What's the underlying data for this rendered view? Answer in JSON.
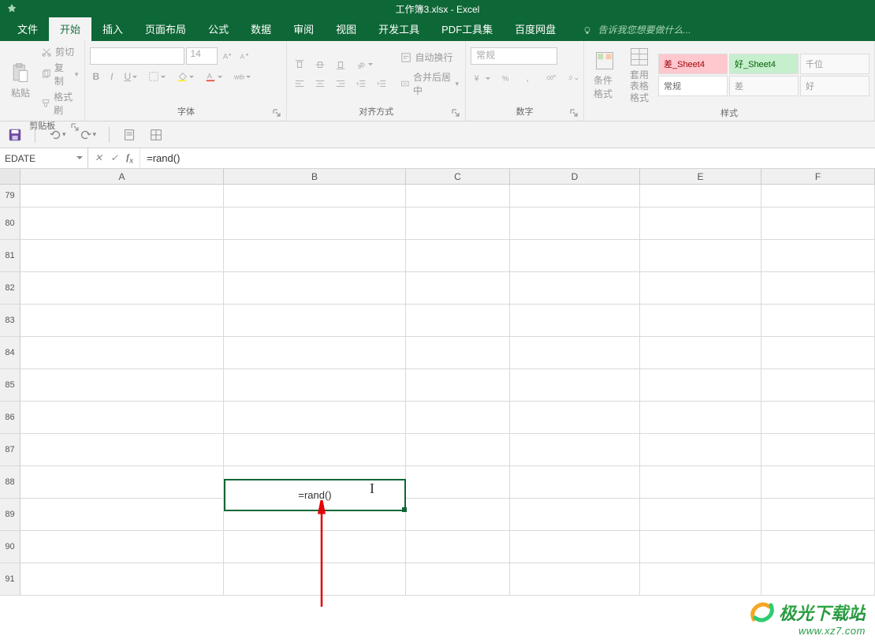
{
  "title": "工作簿3.xlsx - Excel",
  "tabs": [
    "文件",
    "开始",
    "插入",
    "页面布局",
    "公式",
    "数据",
    "审阅",
    "视图",
    "开发工具",
    "PDF工具集",
    "百度网盘"
  ],
  "active_tab_index": 1,
  "tell_me": "告诉我您想要做什么...",
  "clipboard": {
    "paste": "粘贴",
    "cut": "剪切",
    "copy": "复制",
    "format_painter": "格式刷",
    "label": "剪贴板"
  },
  "font": {
    "name": "",
    "size": "14",
    "bold": "B",
    "italic": "I",
    "underline": "U",
    "label": "字体"
  },
  "align": {
    "wrap": "自动换行",
    "merge": "合并后居中",
    "label": "对齐方式"
  },
  "number": {
    "format": "常规",
    "label": "数字"
  },
  "styles": {
    "cond": "条件格式",
    "table": "套用\n表格格式",
    "cells": [
      "差_Sheet4",
      "好_Sheet4",
      "千位",
      "常规",
      "差",
      "好"
    ],
    "label": "样式"
  },
  "namebox": "EDATE",
  "formula": "=rand()",
  "cell_value": "=rand()",
  "cols": [
    "A",
    "B",
    "C",
    "D",
    "E",
    "F"
  ],
  "rows": [
    "79",
    "80",
    "81",
    "82",
    "83",
    "84",
    "85",
    "86",
    "87",
    "88",
    "89",
    "90",
    "91"
  ],
  "watermark": {
    "brand": "极光下载站",
    "url": "www.xz7.com"
  }
}
